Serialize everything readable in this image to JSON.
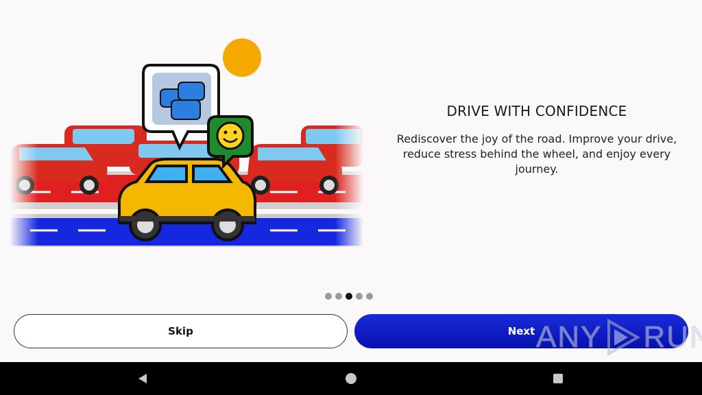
{
  "onboarding": {
    "title": "DRIVE WITH CONFIDENCE",
    "body": "Rediscover the joy of the road. Improve your drive, reduce stress behind the wheel, and enjoy every journey.",
    "page_indicator": {
      "total": 5,
      "current": 3
    }
  },
  "actions": {
    "skip_label": "Skip",
    "next_label": "Next"
  },
  "watermark": {
    "text_left": "ANY",
    "text_right": "RUN"
  },
  "colors": {
    "accent": "#0a18c0",
    "sun": "#f5a800",
    "red_car": "#d82a1e",
    "yellow_car": "#f5b800",
    "green_bubble": "#1f8a2e"
  },
  "icons": {
    "illustration": "traffic-jam-illustration",
    "nav_back": "back-triangle-icon",
    "nav_home": "home-circle-icon",
    "nav_recents": "recents-square-icon"
  }
}
